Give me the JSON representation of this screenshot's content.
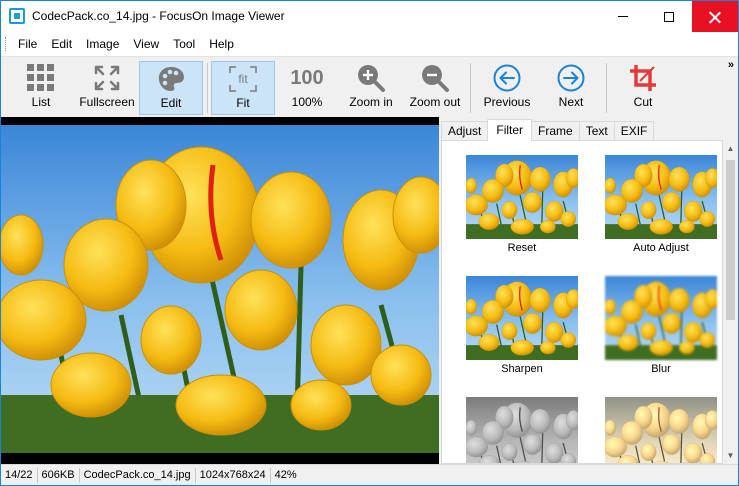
{
  "window": {
    "title": "CodecPack.co_14.jpg - FocusOn Image Viewer"
  },
  "menu": [
    "File",
    "Edit",
    "Image",
    "View",
    "Tool",
    "Help"
  ],
  "toolbar": {
    "list": "List",
    "fullscreen": "Fullscreen",
    "edit": "Edit",
    "fit": "Fit",
    "fit_glyph": "fit",
    "zoom100": "100%",
    "zoom100_glyph": "100",
    "zoom_in": "Zoom in",
    "zoom_out": "Zoom out",
    "previous": "Previous",
    "next": "Next",
    "cut": "Cut",
    "active": "Edit",
    "overflow": "»"
  },
  "panel": {
    "tabs": [
      "Adjust",
      "Filter",
      "Frame",
      "Text",
      "EXIF"
    ],
    "active_tab": "Filter",
    "filters": [
      "Reset",
      "Auto Adjust",
      "Sharpen",
      "Blur"
    ]
  },
  "status": {
    "position": "14/22",
    "size": "606KB",
    "filename": "CodecPack.co_14.jpg",
    "dimensions": "1024x768x24",
    "zoom": "42%"
  },
  "colors": {
    "accent": "#1883d7",
    "active_button": "#cce4f7",
    "close_red": "#e81123",
    "sky": "#5aa0e0",
    "tulip": "#f2b90f"
  }
}
